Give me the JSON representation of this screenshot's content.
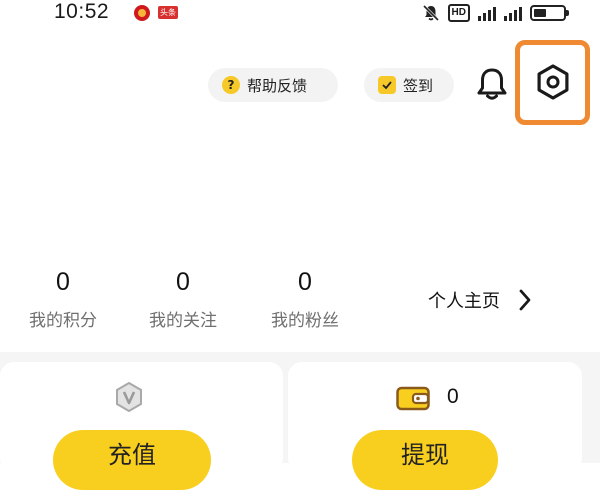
{
  "status_bar": {
    "time": "10:52",
    "badge": "头条",
    "hd_label": "HD"
  },
  "top_actions": {
    "help_label": "帮助反馈",
    "checkin_label": "签到"
  },
  "stats": [
    {
      "value": "0",
      "label": "我的积分"
    },
    {
      "value": "0",
      "label": "我的关注"
    },
    {
      "value": "0",
      "label": "我的粉丝"
    }
  ],
  "profile_link": "个人主页",
  "wallet": {
    "balance": "0",
    "recharge_label": "充值",
    "withdraw_label": "提现"
  },
  "colors": {
    "accent_yellow": "#f8cf1e",
    "highlight_orange": "#ef8a33"
  },
  "icons": [
    "bell-icon",
    "settings-icon",
    "help-icon",
    "checkin-icon",
    "vip-icon",
    "wallet-icon",
    "chevron-right-icon"
  ]
}
